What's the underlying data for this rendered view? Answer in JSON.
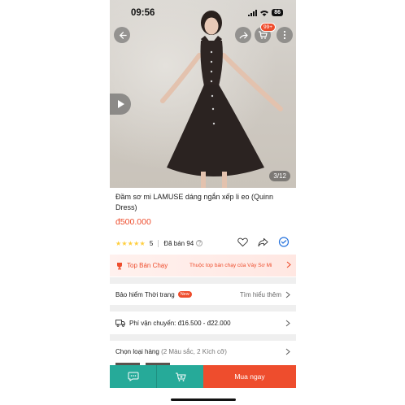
{
  "status_bar": {
    "time": "09:56",
    "battery": "86"
  },
  "header": {
    "cart_badge": "99+"
  },
  "gallery": {
    "counter": "3/12"
  },
  "product": {
    "title": "Đầm sơ mi LAMUSE dáng ngắn xếp li eo (Quinn Dress)",
    "price": "đ500.000",
    "stars": "★★★★★",
    "rating": "5",
    "sold": "Đã bán 94"
  },
  "top_seller": {
    "label": "Top Bán Chạy",
    "description": "Thuộc top bán chạy của Váy Sơ Mi"
  },
  "insurance": {
    "label": "Bảo hiểm Thời trang",
    "badge": "New",
    "link": "Tìm hiểu thêm"
  },
  "shipping": {
    "label": "Phí vận chuyển: đ16.500 - đ22.000"
  },
  "variants": {
    "label": "Chọn loại hàng",
    "detail": "(2 Màu sắc, 2 Kích cỡ)"
  },
  "bottom_bar": {
    "buy_label": "Mua ngay"
  },
  "colors": {
    "accent": "#ee4d2d",
    "teal": "#26aa99",
    "star": "#ffce3d"
  }
}
